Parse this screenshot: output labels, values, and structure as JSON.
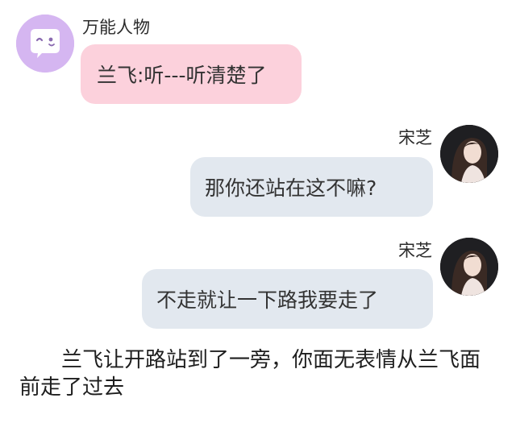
{
  "messages": [
    {
      "sender": "万能人物",
      "side": "left",
      "text": "兰飞:听---听清楚了",
      "bubble_color": "#fcd1dc"
    },
    {
      "sender": "宋芝",
      "side": "right",
      "text": "那你还站在这不嘛?",
      "bubble_color": "#e2e8ef"
    },
    {
      "sender": "宋芝",
      "side": "right",
      "text": "不走就让一下路我要走了",
      "bubble_color": "#e2e8ef"
    }
  ],
  "narration": "兰飞让开路站到了一旁，你面无表情从兰飞面前走了过去",
  "icons": {
    "left_avatar": "speech-bubble-face-icon",
    "right_avatar": "user-photo-avatar"
  },
  "colors": {
    "left_avatar_bg": "#d5b6f1",
    "left_bubble": "#fcd1dc",
    "right_bubble": "#e2e8ef"
  }
}
